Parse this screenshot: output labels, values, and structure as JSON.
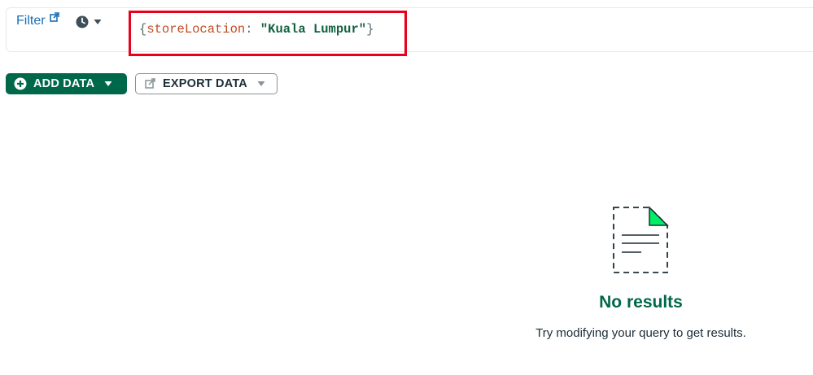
{
  "filter": {
    "label": "Filter",
    "query": {
      "open_brace": "{",
      "key": "storeLocation",
      "colon": ": ",
      "value": "\"Kuala Lumpur\"",
      "close_brace": "}"
    }
  },
  "toolbar": {
    "add_data_label": "ADD DATA",
    "export_data_label": "EXPORT DATA"
  },
  "empty_state": {
    "title": "No results",
    "subtitle": "Try modifying your query to get results."
  },
  "colors": {
    "brand_green": "#00684a",
    "highlight_red": "#e8001c",
    "link_blue": "#1a6fb6"
  },
  "icons": [
    "external-link-icon",
    "clock-icon",
    "chevron-down-icon",
    "plus-circle-icon",
    "export-icon",
    "empty-document-icon"
  ]
}
